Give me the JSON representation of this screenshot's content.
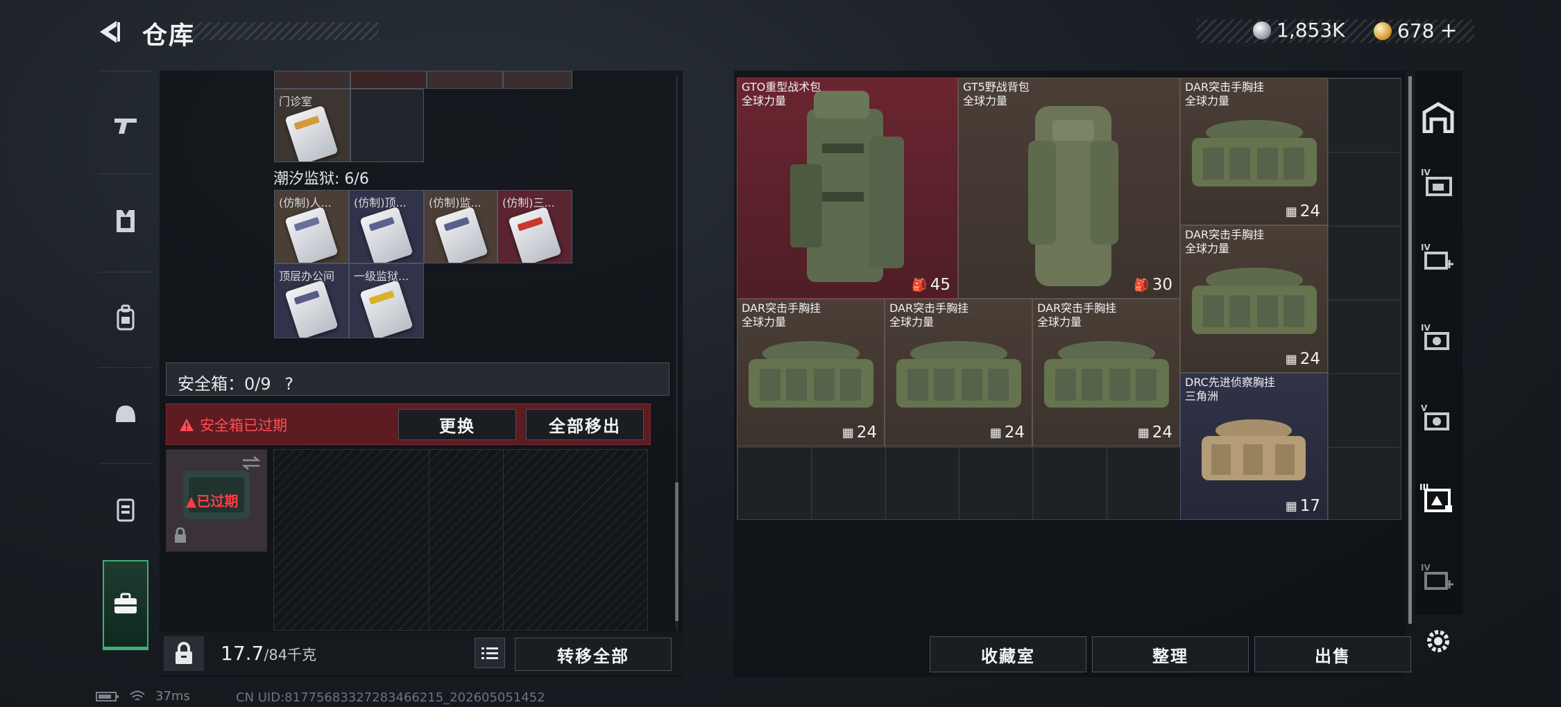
{
  "header": {
    "title": "仓库"
  },
  "currency": {
    "silver": "1,853K",
    "gold": "678",
    "gold_add": "+"
  },
  "left_panel": {
    "clinic_label": "门诊室",
    "prison_title": "潮汐监狱: 6/6",
    "prison_cards": [
      {
        "label": "(仿制)人...",
        "stripe": "#6a6f9a"
      },
      {
        "label": "(仿制)顶...",
        "stripe": "#5c6290"
      },
      {
        "label": "(仿制)监...",
        "stripe": "#5a5e8a"
      },
      {
        "label": "(仿制)三...",
        "stripe": "#c8382e"
      },
      {
        "label": "顶层办公间",
        "stripe": "#565c86"
      },
      {
        "label": "一级监狱...",
        "stripe": "#d8b22a"
      }
    ],
    "safe_box_label": "安全箱：0/9",
    "safe_box_help": "?",
    "safe_expired_text": "安全箱已过期",
    "replace_button": "更换",
    "move_all_out_button": "全部移出",
    "case_expired_label": "已过期",
    "weight_current": "17.7",
    "weight_max": "/84千克",
    "transfer_all_button": "转移全部"
  },
  "inventory": {
    "items": [
      {
        "name": "GTO重型战术包",
        "tag": "全球力量",
        "capacity": "45",
        "cap_icon": "backpack-icon",
        "bg": "red"
      },
      {
        "name": "GT5野战背包",
        "tag": "全球力量",
        "capacity": "30",
        "cap_icon": "backpack-icon",
        "bg": "brown"
      },
      {
        "name": "DAR突击手胸挂",
        "tag": "全球力量",
        "capacity": "24",
        "cap_icon": "vest-icon",
        "bg": "brown"
      },
      {
        "name": "DAR突击手胸挂",
        "tag": "全球力量",
        "capacity": "24",
        "cap_icon": "vest-icon",
        "bg": "brown"
      },
      {
        "name": "DAR突击手胸挂",
        "tag": "全球力量",
        "capacity": "24",
        "cap_icon": "vest-icon",
        "bg": "brown"
      },
      {
        "name": "DAR突击手胸挂",
        "tag": "全球力量",
        "capacity": "24",
        "cap_icon": "vest-icon",
        "bg": "brown"
      },
      {
        "name": "DAR突击手胸挂",
        "tag": "全球力量",
        "capacity": "24",
        "cap_icon": "vest-icon",
        "bg": "brown"
      },
      {
        "name": "DRC先进侦察胸挂",
        "tag": "三角洲",
        "capacity": "17",
        "cap_icon": "vest-icon",
        "bg": "navy"
      }
    ]
  },
  "bottom_buttons": {
    "collection": "收藏室",
    "organize": "整理",
    "sell": "出售"
  },
  "status_bar": {
    "ping": "37ms",
    "uid": "CN UID:81775683327283466215_202605051452"
  },
  "right_rail_labels": [
    "IV",
    "IV",
    "IV",
    "V",
    "III",
    "IV"
  ]
}
